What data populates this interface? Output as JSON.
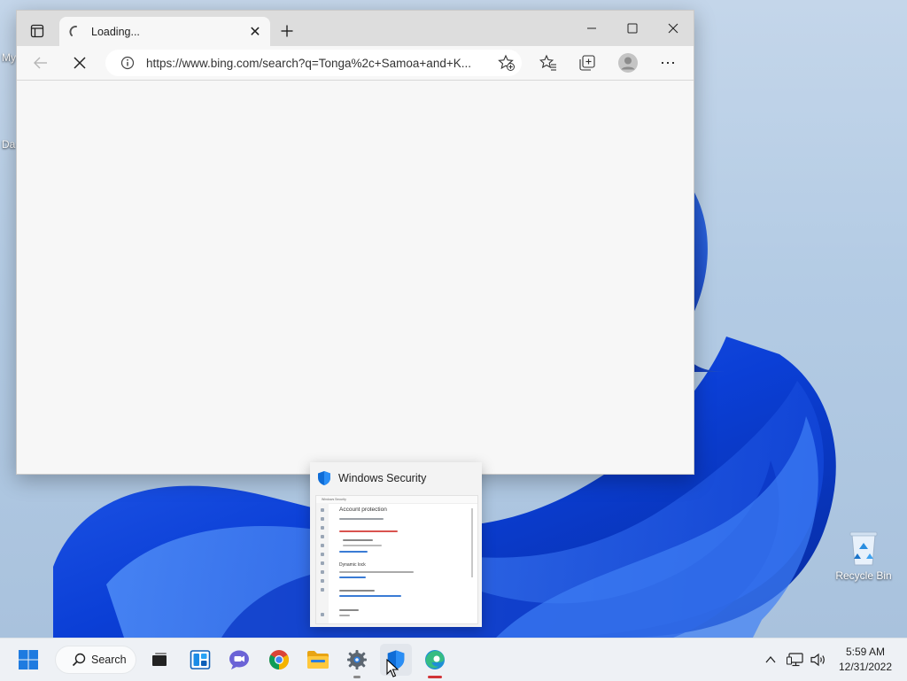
{
  "desktop": {
    "icons": [
      {
        "label": "Recycle Bin",
        "icon": "recycle-bin-icon"
      }
    ],
    "cut_labels": [
      "My",
      "Da"
    ]
  },
  "browser": {
    "tab": {
      "title": "Loading...",
      "icon": "loading-spinner-icon",
      "close": "✕"
    },
    "newtab": "+",
    "window_controls": {
      "minimize": "—",
      "maximize": "☐",
      "close": "✕"
    },
    "address": {
      "url": "https://www.bing.com/search?q=Tonga%2c+Samoa+and+K..."
    },
    "menu": "⋯"
  },
  "preview": {
    "title": "Windows Security",
    "thumb": {
      "window_title": "Windows Security",
      "heading": "Account protection",
      "section2": "Dynamic lock"
    }
  },
  "taskbar": {
    "search_label": "Search",
    "clock": {
      "time": "5:59 AM",
      "date": "12/31/2022"
    }
  },
  "colors": {
    "accent_blue": "#0067c0",
    "edge_indicator": "#d13438",
    "running_indicator": "#8a8a8a"
  }
}
